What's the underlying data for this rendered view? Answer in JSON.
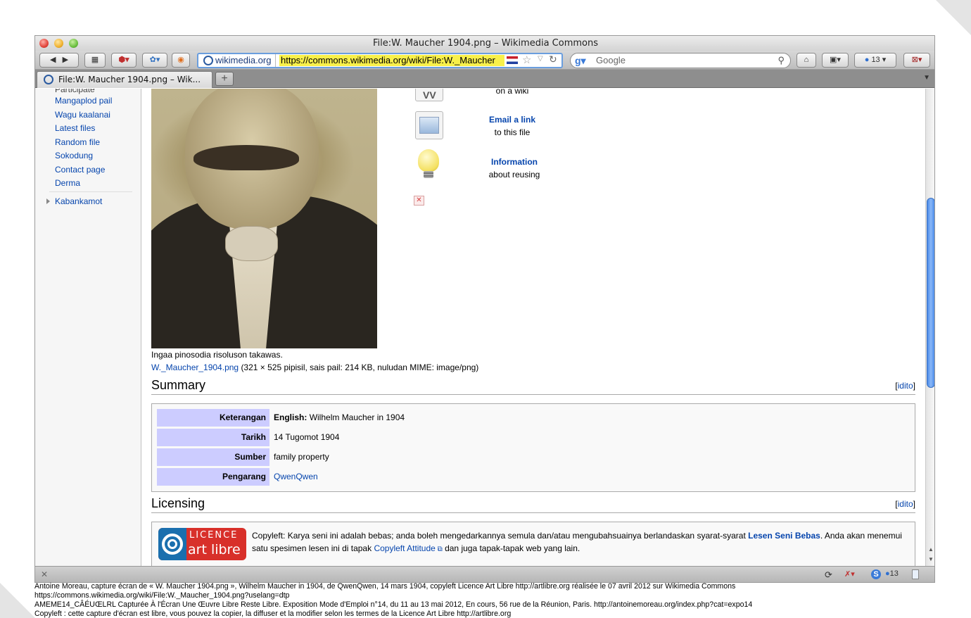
{
  "window": {
    "title": "File:W. Maucher 1904.png – Wikimedia Commons",
    "site_label": "wikimedia.org",
    "url": "https://commons.wikimedia.org/wiki/File:W._Maucher",
    "search_placeholder": "Google",
    "tab_title": "File:W. Maucher 1904.png – Wik...",
    "new_tab": "+",
    "notif_count": "13",
    "status_count": "13"
  },
  "sidebar": {
    "cut_label": "Participate",
    "links": [
      "Mangaplod pail",
      "Wagu kaalanai",
      "Latest files",
      "Random file",
      "Sokodung",
      "Contact page",
      "Derma"
    ],
    "section": "Kabankamot"
  },
  "actions": {
    "wiki_sub": "on a wiki",
    "email_title": "Email a link",
    "email_sub": "to this file",
    "info_title": "Information",
    "info_sub": "about reusing"
  },
  "file": {
    "caption": "Ingaa pinosodia risoluson takawas.",
    "name": "W._Maucher_1904.png",
    "meta": "(321 × 525 pipisil, sais pail: 214 KB, nuludan MIME: image/png)"
  },
  "summary": {
    "heading": "Summary",
    "edit": "idito",
    "rows": [
      {
        "label": "Keterangan",
        "value_bold": "English:",
        "value": "Wilhelm Maucher in 1904"
      },
      {
        "label": "Tarikh",
        "value_bold": "",
        "value": "14 Tugomot 1904"
      },
      {
        "label": "Sumber",
        "value_bold": "",
        "value": "family property"
      },
      {
        "label": "Pengarang",
        "value_bold": "",
        "value": "QwenQwen"
      }
    ]
  },
  "licensing": {
    "heading": "Licensing",
    "edit": "idito",
    "logo_top": "LICENCE",
    "logo_bottom": "art libre",
    "text1": "Copyleft: Karya seni ini adalah bebas; anda boleh mengedarkannya semula dan/atau mengubahsuainya berlandaskan syarat-syarat ",
    "link1": "Lesen Seni Bebas",
    "text2": ". Anda akan menemui satu spesimen lesen ini di tapak ",
    "link2": "Copyleft Attitude",
    "text3": " dan juga tapak-tapak web yang lain."
  },
  "footer_lines": [
    "Antoine Moreau, capture écran de « W. Maucher 1904.png », Wilhelm Maucher in 1904, de QwenQwen, 14 mars 1904, copyleft Licence Art Libre http://artlibre.org réalisée le 07 avril 2012 sur Wikimedia Commons",
    "https://commons.wikimedia.org/wiki/File:W._Maucher_1904.png?uselang=dtp",
    "AMEME14_CÂÉUŒLRL Capturée À l'Écran Une Œuvre Libre Reste Libre. Exposition Mode d'Emploi n°14, du 11 au 13 mai 2012, En cours, 56 rue de la Réunion, Paris. http://antoinemoreau.org/index.php?cat=expo14",
    "Copyleft : cette capture d'écran est libre, vous pouvez la copier, la diffuser et la modifier selon les termes de la Licence Art Libre http://artlibre.org"
  ]
}
